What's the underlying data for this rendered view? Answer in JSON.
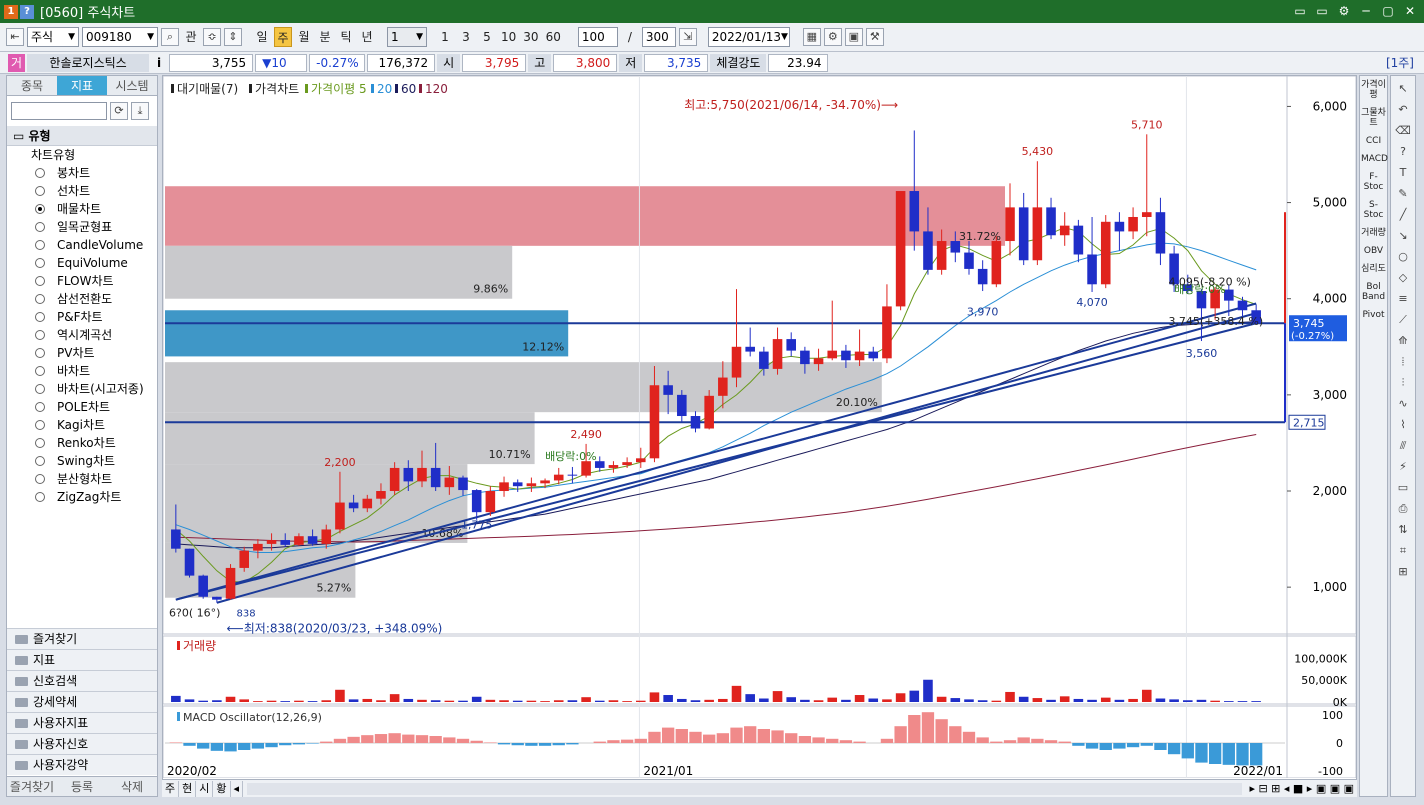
{
  "window": {
    "badge1": "1",
    "badge2": "?",
    "title": "[0560] 주식차트",
    "controls": [
      "▭",
      "▭",
      "⚙",
      "─",
      "▢",
      "✕"
    ]
  },
  "toolbar": {
    "market": "주식",
    "code": "009180",
    "gwan": "관",
    "periods": [
      "일",
      "주",
      "월",
      "분",
      "틱",
      "년"
    ],
    "active_period": "주",
    "interval": "1",
    "quick_intervals": [
      "1",
      "3",
      "5",
      "10",
      "30",
      "60"
    ],
    "count": "100",
    "slash": "/",
    "max_count": "300",
    "date": "2022/01/13"
  },
  "quote": {
    "flag": "거",
    "name": "한솔로지스틱스",
    "info": "i",
    "price": "3,755",
    "change": "▼10",
    "change_pct": "-0.27%",
    "volume": "176,372",
    "open_label": "시",
    "open": "3,795",
    "high_label": "고",
    "high": "3,800",
    "low_label": "저",
    "low": "3,735",
    "strength_label": "체결강도",
    "strength": "23.94",
    "unit": "[1주]"
  },
  "left_panel": {
    "tabs": [
      "종목",
      "지표",
      "시스템"
    ],
    "active_tab": "지표",
    "section": "유형",
    "category": "차트유형",
    "chart_types": [
      "봉차트",
      "선차트",
      "매물차트",
      "일목균형표",
      "CandleVolume",
      "EquiVolume",
      "FLOW차트",
      "삼선전환도",
      "P&F차트",
      "역시계곡선",
      "PV차트",
      "바차트",
      "바차트(시고저종)",
      "POLE차트",
      "Kagi차트",
      "Renko차트",
      "Swing차트",
      "분산형차트",
      "ZigZag차트"
    ],
    "selected_type": "매물차트",
    "folders": [
      "즐겨찾기",
      "지표",
      "신호검색",
      "강세약세",
      "사용자지표",
      "사용자신호",
      "사용자강약"
    ],
    "bottom": [
      "즐겨찾기",
      "등록",
      "삭제"
    ]
  },
  "chart": {
    "legend": {
      "vp": "대기매물(7)",
      "price": "가격차트",
      "ma_label": "가격이평 5",
      "ma20": "20",
      "ma60": "60",
      "ma120": "120"
    },
    "colors": {
      "up": "#e0231e",
      "down": "#1f2ec8",
      "ma5": "#6a9a1e",
      "ma20": "#2a8fd6",
      "ma60": "#1a1a5a",
      "ma120": "#8a1f3c",
      "vp_gray": "#c9c9cc",
      "vp_red": "#e48f98",
      "vp_blue": "#3f97c7",
      "trend": "#1b3a99"
    },
    "price_axis": [
      "6,000",
      "5,000",
      "4,000",
      "3,000",
      "2,000",
      "1,000"
    ],
    "price_axis_values": [
      6000,
      5000,
      4000,
      3000,
      2000,
      1000
    ],
    "y_min": 700,
    "y_max": 6150,
    "volume_profile": [
      {
        "low": 4550,
        "high": 5170,
        "label": "31.72%",
        "color": "red",
        "width_frac": 0.75
      },
      {
        "low": 4000,
        "high": 4550,
        "label": "9.86%",
        "color": "gray",
        "width_frac": 0.31
      },
      {
        "low": 3400,
        "high": 3880,
        "label": "12.12%",
        "color": "blue",
        "width_frac": 0.36
      },
      {
        "low": 2820,
        "high": 3340,
        "label": "20.10%",
        "color": "gray",
        "width_frac": 0.64
      },
      {
        "low": 2280,
        "high": 2820,
        "label": "10.71%",
        "color": "gray",
        "width_frac": 0.33
      },
      {
        "low": 1460,
        "high": 2280,
        "label": "10.68%",
        "color": "gray",
        "width_frac": 0.27
      },
      {
        "low": 890,
        "high": 1460,
        "label": "5.27%",
        "color": "gray",
        "width_frac": 0.17
      }
    ],
    "hlines": [
      3745,
      2715
    ],
    "hline_labels": [
      "3,745",
      "(-0.27%)",
      "2,715"
    ],
    "annotations": {
      "high": "최고:5,750(2021/06/14, -34.70%)⟶",
      "low": "⟵최저:838(2020/03/23, +348.09%)",
      "p2200": "2,200",
      "p2490": "2,490",
      "p5430": "5,430",
      "p5710": "5,710",
      "p3970": "3,970",
      "p4070": "4,070",
      "p3560": "3,560",
      "p1775": "1,775",
      "p838": "838",
      "div1": "배당락:0%",
      "div2": "배당락:0%",
      "cur1": "4,095(-8.20 %)",
      "cur2": "3,745(+358.4 %)",
      "left_mark": "6?0( 16°)"
    },
    "candles": [
      [
        1600,
        1860,
        1360,
        1400
      ],
      [
        1400,
        1400,
        1100,
        1120
      ],
      [
        1120,
        1130,
        880,
        900
      ],
      [
        900,
        900,
        838,
        870
      ],
      [
        880,
        1240,
        870,
        1200
      ],
      [
        1200,
        1420,
        1160,
        1380
      ],
      [
        1380,
        1500,
        1300,
        1450
      ],
      [
        1450,
        1560,
        1380,
        1490
      ],
      [
        1490,
        1560,
        1420,
        1440
      ],
      [
        1440,
        1560,
        1430,
        1530
      ],
      [
        1530,
        1600,
        1430,
        1450
      ],
      [
        1450,
        1650,
        1400,
        1600
      ],
      [
        1600,
        2200,
        1560,
        1880
      ],
      [
        1880,
        1960,
        1780,
        1820
      ],
      [
        1820,
        1960,
        1780,
        1920
      ],
      [
        1920,
        2080,
        1860,
        2000
      ],
      [
        2000,
        2300,
        1960,
        2240
      ],
      [
        2240,
        2320,
        2000,
        2100
      ],
      [
        2100,
        2420,
        2040,
        2240
      ],
      [
        2240,
        2500,
        2000,
        2040
      ],
      [
        2040,
        2260,
        1960,
        2140
      ],
      [
        2140,
        2160,
        1950,
        2010
      ],
      [
        2010,
        2020,
        1700,
        1780
      ],
      [
        1780,
        2050,
        1740,
        2000
      ],
      [
        2000,
        2150,
        1940,
        2090
      ],
      [
        2090,
        2120,
        1990,
        2050
      ],
      [
        2050,
        2140,
        1990,
        2080
      ],
      [
        2080,
        2130,
        2030,
        2110
      ],
      [
        2110,
        2240,
        2070,
        2170
      ],
      [
        2170,
        2250,
        2080,
        2160
      ],
      [
        2160,
        2490,
        2140,
        2310
      ],
      [
        2310,
        2360,
        2200,
        2240
      ],
      [
        2240,
        2310,
        2190,
        2270
      ],
      [
        2270,
        2350,
        2240,
        2300
      ],
      [
        2300,
        2450,
        2240,
        2340
      ],
      [
        2340,
        3300,
        2300,
        3100
      ],
      [
        3100,
        3250,
        2800,
        3000
      ],
      [
        3000,
        3050,
        2720,
        2780
      ],
      [
        2780,
        2830,
        2610,
        2650
      ],
      [
        2650,
        3050,
        2640,
        2990
      ],
      [
        2990,
        3350,
        2860,
        3180
      ],
      [
        3180,
        4100,
        3080,
        3500
      ],
      [
        3500,
        3700,
        3400,
        3450
      ],
      [
        3450,
        3500,
        3200,
        3270
      ],
      [
        3270,
        3700,
        3210,
        3580
      ],
      [
        3580,
        3650,
        3400,
        3460
      ],
      [
        3460,
        3500,
        3220,
        3320
      ],
      [
        3320,
        3480,
        3250,
        3380
      ],
      [
        3380,
        3980,
        3360,
        3460
      ],
      [
        3460,
        3520,
        3280,
        3360
      ],
      [
        3360,
        3680,
        3300,
        3450
      ],
      [
        3450,
        3500,
        3350,
        3380
      ],
      [
        3380,
        4150,
        3330,
        3920
      ],
      [
        3920,
        5100,
        3880,
        5120
      ],
      [
        5120,
        5750,
        4500,
        4700
      ],
      [
        4700,
        4950,
        4250,
        4300
      ],
      [
        4300,
        4720,
        4250,
        4600
      ],
      [
        4600,
        4700,
        4380,
        4480
      ],
      [
        4480,
        4600,
        4250,
        4310
      ],
      [
        4310,
        4400,
        4080,
        4150
      ],
      [
        4150,
        4650,
        4120,
        4600
      ],
      [
        4600,
        5200,
        4450,
        4950
      ],
      [
        4950,
        5100,
        4350,
        4400
      ],
      [
        4400,
        5430,
        4350,
        4950
      ],
      [
        4950,
        5050,
        4620,
        4660
      ],
      [
        4660,
        4900,
        4550,
        4760
      ],
      [
        4760,
        4820,
        4380,
        4460
      ],
      [
        4460,
        4850,
        4070,
        4150
      ],
      [
        4150,
        4870,
        4110,
        4800
      ],
      [
        4800,
        4900,
        4500,
        4700
      ],
      [
        4700,
        4950,
        4620,
        4850
      ],
      [
        4850,
        5710,
        4650,
        4900
      ],
      [
        4900,
        5050,
        4350,
        4470
      ],
      [
        4470,
        4550,
        4070,
        4150
      ],
      [
        4150,
        4250,
        4050,
        4080
      ],
      [
        4080,
        4100,
        3560,
        3900
      ],
      [
        3900,
        4120,
        3780,
        4095
      ],
      [
        4095,
        4150,
        3820,
        3980
      ],
      [
        3980,
        4020,
        3810,
        3880
      ],
      [
        3880,
        3940,
        3735,
        3745
      ]
    ],
    "ma5": [
      1600,
      1480,
      1320,
      1170,
      1060,
      1050,
      1140,
      1260,
      1400,
      1460,
      1480,
      1500,
      1580,
      1650,
      1720,
      1830,
      1960,
      2050,
      2130,
      2160,
      2160,
      2120,
      2080,
      2050,
      2040,
      2020,
      2040,
      2050,
      2080,
      2120,
      2180,
      2210,
      2230,
      2260,
      2300,
      2450,
      2570,
      2650,
      2700,
      2780,
      2900,
      3000,
      3130,
      3280,
      3380,
      3400,
      3380,
      3380,
      3400,
      3410,
      3420,
      3420,
      3500,
      3720,
      4050,
      4300,
      4500,
      4560,
      4520,
      4450,
      4390,
      4470,
      4590,
      4620,
      4680,
      4740,
      4700,
      4570,
      4460,
      4470,
      4560,
      4690,
      4730,
      4630,
      4500,
      4290,
      4150,
      4050,
      3990,
      3940
    ],
    "ma20": [
      1650,
      1600,
      1540,
      1480,
      1420,
      1380,
      1360,
      1360,
      1370,
      1390,
      1410,
      1420,
      1450,
      1490,
      1530,
      1580,
      1640,
      1700,
      1770,
      1840,
      1900,
      1950,
      1980,
      2000,
      2010,
      2020,
      2030,
      2040,
      2060,
      2080,
      2100,
      2120,
      2140,
      2160,
      2180,
      2230,
      2280,
      2320,
      2360,
      2400,
      2460,
      2530,
      2600,
      2680,
      2750,
      2820,
      2880,
      2940,
      3000,
      3060,
      3110,
      3160,
      3220,
      3300,
      3400,
      3500,
      3610,
      3720,
      3820,
      3900,
      3980,
      4070,
      4150,
      4220,
      4290,
      4350,
      4400,
      4440,
      4470,
      4500,
      4530,
      4560,
      4580,
      4570,
      4540,
      4500,
      4450,
      4400,
      4350,
      4300
    ],
    "ma60": [
      1450,
      1440,
      1430,
      1420,
      1410,
      1410,
      1410,
      1410,
      1420,
      1430,
      1440,
      1450,
      1460,
      1480,
      1500,
      1520,
      1540,
      1560,
      1580,
      1600,
      1620,
      1640,
      1660,
      1680,
      1700,
      1720,
      1740,
      1760,
      1790,
      1820,
      1850,
      1880,
      1910,
      1940,
      1970,
      2000,
      2030,
      2060,
      2090,
      2120,
      2160,
      2200,
      2240,
      2280,
      2320,
      2360,
      2400,
      2440,
      2480,
      2520,
      2560,
      2600,
      2640,
      2690,
      2740,
      2800,
      2860,
      2920,
      2980,
      3040,
      3100,
      3160,
      3220,
      3280,
      3340,
      3400,
      3460,
      3510,
      3560,
      3600,
      3640,
      3670,
      3700,
      3720,
      3730,
      3740,
      3745,
      3750,
      3755,
      3760
    ],
    "ma120": [
      1520,
      1515,
      1510,
      1505,
      1500,
      1495,
      1490,
      1485,
      1480,
      1478,
      1476,
      1474,
      1472,
      1470,
      1472,
      1475,
      1480,
      1485,
      1490,
      1495,
      1500,
      1505,
      1510,
      1515,
      1520,
      1525,
      1530,
      1536,
      1542,
      1548,
      1555,
      1562,
      1570,
      1578,
      1586,
      1595,
      1605,
      1615,
      1625,
      1636,
      1648,
      1660,
      1673,
      1686,
      1700,
      1715,
      1730,
      1746,
      1762,
      1780,
      1800,
      1820,
      1842,
      1865,
      1890,
      1915,
      1940,
      1966,
      1992,
      2018,
      2045,
      2072,
      2100,
      2128,
      2156,
      2185,
      2214,
      2243,
      2272,
      2302,
      2332,
      2362,
      2392,
      2422,
      2452,
      2480,
      2508,
      2536,
      2562,
      2588
    ],
    "trendlines": [
      [
        0,
        870,
        79,
        3745
      ],
      [
        0,
        870,
        79,
        3950
      ],
      [
        3,
        838,
        79,
        3850
      ]
    ],
    "volume": {
      "title": "거래량",
      "axis": [
        "100,000K",
        "50,000K",
        "0K"
      ],
      "max": 110000,
      "values": [
        14000,
        6000,
        3000,
        4000,
        12000,
        6000,
        2000,
        3000,
        2000,
        3000,
        2000,
        4000,
        28000,
        6000,
        7000,
        4000,
        18000,
        7000,
        5000,
        4000,
        3000,
        3000,
        12000,
        5000,
        4000,
        3000,
        3000,
        2000,
        4000,
        4000,
        11000,
        3000,
        4000,
        2000,
        3000,
        22000,
        16000,
        7000,
        4000,
        5000,
        7000,
        37000,
        18000,
        8000,
        25000,
        11000,
        5000,
        4000,
        10000,
        5000,
        16000,
        8000,
        6000,
        20000,
        26000,
        51000,
        12000,
        9000,
        6000,
        4000,
        3000,
        23000,
        12000,
        9000,
        5000,
        13000,
        7000,
        5000,
        10000,
        5000,
        7000,
        28000,
        8000,
        6000,
        4000,
        5000,
        3000,
        2000,
        2000,
        2000
      ]
    },
    "macd": {
      "title": "MACD Oscillator(12,26,9)",
      "axis": [
        "100",
        "0",
        "-100"
      ],
      "values": [
        2,
        -10,
        -20,
        -28,
        -30,
        -25,
        -20,
        -15,
        -8,
        -5,
        -2,
        5,
        15,
        22,
        28,
        32,
        35,
        30,
        28,
        25,
        20,
        15,
        8,
        2,
        -5,
        -8,
        -10,
        -10,
        -8,
        -5,
        0,
        5,
        10,
        12,
        15,
        40,
        55,
        50,
        40,
        30,
        35,
        55,
        60,
        50,
        45,
        35,
        25,
        20,
        15,
        10,
        5,
        0,
        15,
        60,
        100,
        110,
        85,
        60,
        40,
        20,
        5,
        10,
        20,
        15,
        10,
        5,
        -10,
        -20,
        -25,
        -20,
        -15,
        -10,
        -25,
        -40,
        -55,
        -70,
        -75,
        -78,
        -80,
        -80
      ]
    },
    "x_axis": [
      "2020/02",
      "2021/01",
      "2022/01"
    ]
  },
  "right_indicators": [
    "가격이평",
    "그물차트",
    "CCI",
    "MACD",
    "F-Stoc",
    "S-Stoc",
    "거래량",
    "OBV",
    "심리도",
    "Bol Band",
    "Pivot"
  ],
  "bottom_controls": [
    "주",
    "현",
    "시",
    "황",
    "◂"
  ]
}
